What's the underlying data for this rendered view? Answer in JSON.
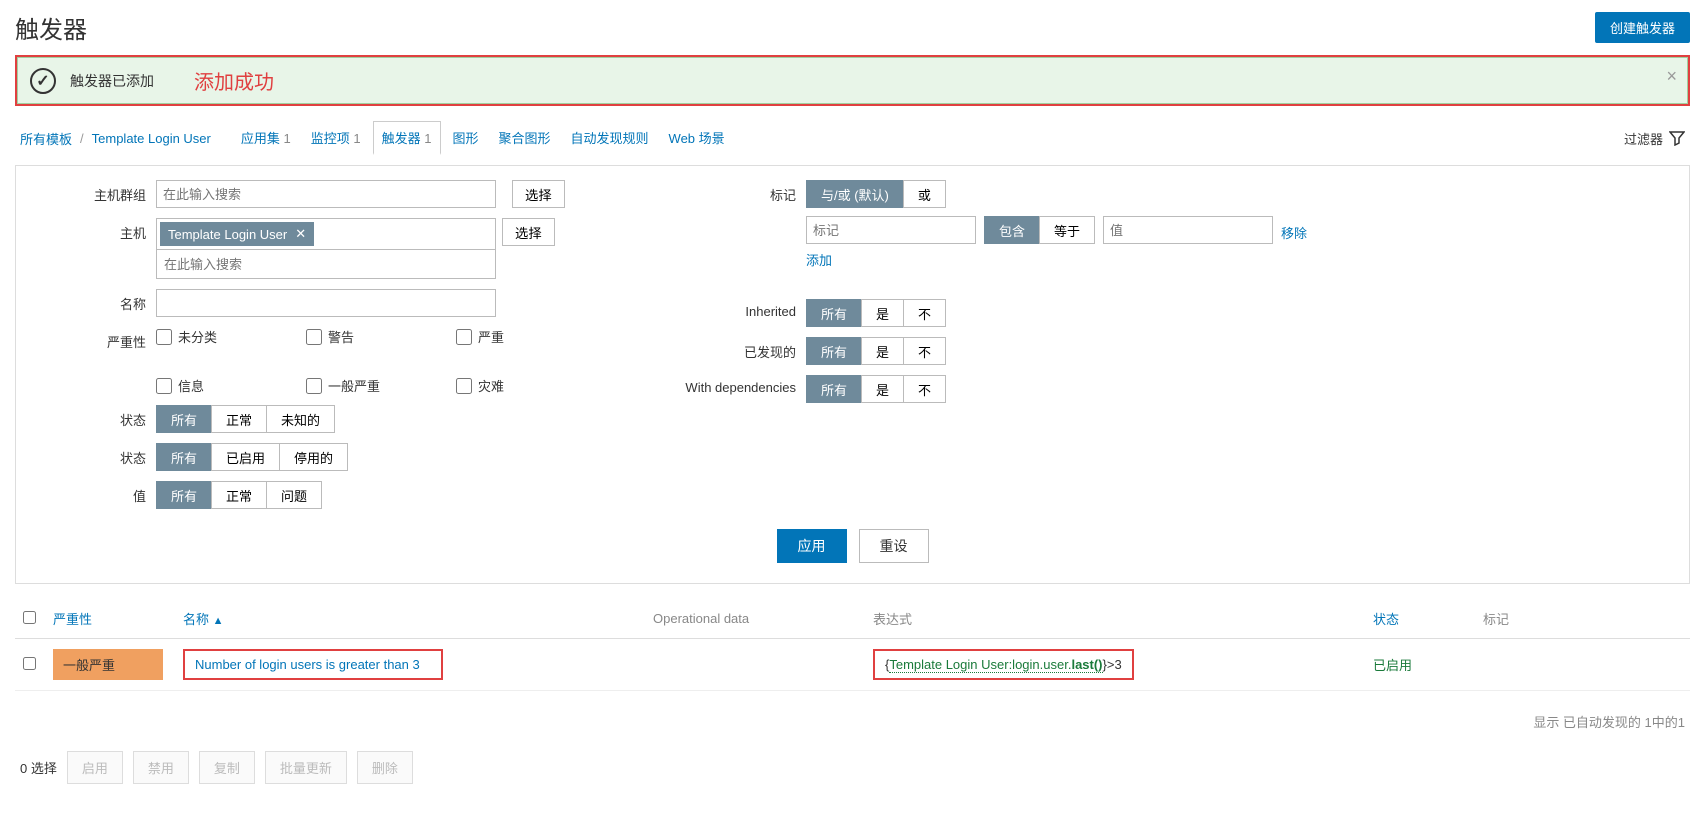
{
  "header": {
    "title": "触发器",
    "create_button": "创建触发器"
  },
  "banner": {
    "text": "触发器已添加",
    "annotation": "添加成功"
  },
  "breadcrumb": {
    "all_templates": "所有模板",
    "template": "Template Login User"
  },
  "tabs": [
    {
      "label": "应用集",
      "count": "1"
    },
    {
      "label": "监控项",
      "count": "1"
    },
    {
      "label": "触发器",
      "count": "1",
      "active": true
    },
    {
      "label": "图形",
      "count": ""
    },
    {
      "label": "聚合图形",
      "count": ""
    },
    {
      "label": "自动发现规则",
      "count": ""
    },
    {
      "label": "Web 场景",
      "count": ""
    }
  ],
  "filter_link": "过滤器",
  "filter": {
    "left": {
      "host_group_label": "主机群组",
      "host_group_placeholder": "在此输入搜索",
      "host_group_select": "选择",
      "host_label": "主机",
      "host_tag": "Template Login User",
      "host_placeholder": "在此输入搜索",
      "host_select": "选择",
      "name_label": "名称",
      "severity_label": "严重性",
      "severity_opts": [
        "未分类",
        "警告",
        "严重",
        "信息",
        "一般严重",
        "灾难"
      ],
      "state_label": "状态",
      "state_opts": [
        "所有",
        "正常",
        "未知的"
      ],
      "status_label": "状态",
      "status_opts": [
        "所有",
        "已启用",
        "停用的"
      ],
      "value_label": "值",
      "value_opts": [
        "所有",
        "正常",
        "问题"
      ]
    },
    "right": {
      "tag_label": "标记",
      "tag_andor": [
        "与/或  (默认)",
        "或"
      ],
      "tag_name_placeholder": "标记",
      "tag_match": [
        "包含",
        "等于"
      ],
      "tag_value_placeholder": "值",
      "tag_remove": "移除",
      "tag_add": "添加",
      "inherited_label": "Inherited",
      "inherited_opts": [
        "所有",
        "是",
        "不"
      ],
      "discovered_label": "已发现的",
      "discovered_opts": [
        "所有",
        "是",
        "不"
      ],
      "deps_label": "With dependencies",
      "deps_opts": [
        "所有",
        "是",
        "不"
      ]
    },
    "apply": "应用",
    "reset": "重设"
  },
  "table": {
    "columns": {
      "severity": "严重性",
      "name": "名称",
      "opdata": "Operational data",
      "expression": "表达式",
      "status": "状态",
      "tags": "标记"
    },
    "rows": [
      {
        "severity": "一般严重",
        "name": "Number of login users is greater than 3",
        "expression_prefix": "{",
        "expression_link": "Template Login User:login.user.",
        "expression_bold": "last()",
        "expression_suffix": "}>3",
        "status": "已启用"
      }
    ],
    "footer": "显示 已自动发现的 1中的1"
  },
  "bottom": {
    "selected": "0 选择",
    "buttons": [
      "启用",
      "禁用",
      "复制",
      "批量更新",
      "删除"
    ]
  }
}
